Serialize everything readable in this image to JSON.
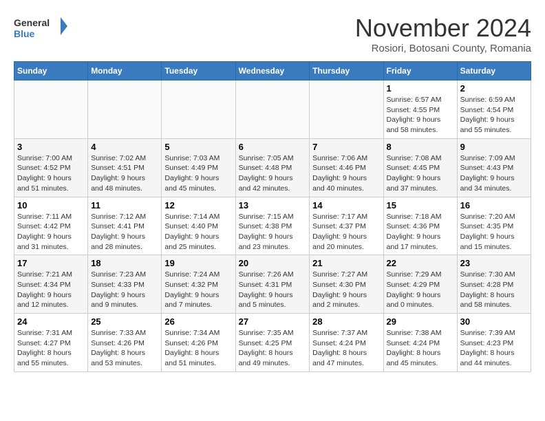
{
  "logo": {
    "line1": "General",
    "line2": "Blue"
  },
  "title": "November 2024",
  "subtitle": "Rosiori, Botosani County, Romania",
  "days_of_week": [
    "Sunday",
    "Monday",
    "Tuesday",
    "Wednesday",
    "Thursday",
    "Friday",
    "Saturday"
  ],
  "weeks": [
    [
      {
        "day": "",
        "info": ""
      },
      {
        "day": "",
        "info": ""
      },
      {
        "day": "",
        "info": ""
      },
      {
        "day": "",
        "info": ""
      },
      {
        "day": "",
        "info": ""
      },
      {
        "day": "1",
        "info": "Sunrise: 6:57 AM\nSunset: 4:55 PM\nDaylight: 9 hours and 58 minutes."
      },
      {
        "day": "2",
        "info": "Sunrise: 6:59 AM\nSunset: 4:54 PM\nDaylight: 9 hours and 55 minutes."
      }
    ],
    [
      {
        "day": "3",
        "info": "Sunrise: 7:00 AM\nSunset: 4:52 PM\nDaylight: 9 hours and 51 minutes."
      },
      {
        "day": "4",
        "info": "Sunrise: 7:02 AM\nSunset: 4:51 PM\nDaylight: 9 hours and 48 minutes."
      },
      {
        "day": "5",
        "info": "Sunrise: 7:03 AM\nSunset: 4:49 PM\nDaylight: 9 hours and 45 minutes."
      },
      {
        "day": "6",
        "info": "Sunrise: 7:05 AM\nSunset: 4:48 PM\nDaylight: 9 hours and 42 minutes."
      },
      {
        "day": "7",
        "info": "Sunrise: 7:06 AM\nSunset: 4:46 PM\nDaylight: 9 hours and 40 minutes."
      },
      {
        "day": "8",
        "info": "Sunrise: 7:08 AM\nSunset: 4:45 PM\nDaylight: 9 hours and 37 minutes."
      },
      {
        "day": "9",
        "info": "Sunrise: 7:09 AM\nSunset: 4:43 PM\nDaylight: 9 hours and 34 minutes."
      }
    ],
    [
      {
        "day": "10",
        "info": "Sunrise: 7:11 AM\nSunset: 4:42 PM\nDaylight: 9 hours and 31 minutes."
      },
      {
        "day": "11",
        "info": "Sunrise: 7:12 AM\nSunset: 4:41 PM\nDaylight: 9 hours and 28 minutes."
      },
      {
        "day": "12",
        "info": "Sunrise: 7:14 AM\nSunset: 4:40 PM\nDaylight: 9 hours and 25 minutes."
      },
      {
        "day": "13",
        "info": "Sunrise: 7:15 AM\nSunset: 4:38 PM\nDaylight: 9 hours and 23 minutes."
      },
      {
        "day": "14",
        "info": "Sunrise: 7:17 AM\nSunset: 4:37 PM\nDaylight: 9 hours and 20 minutes."
      },
      {
        "day": "15",
        "info": "Sunrise: 7:18 AM\nSunset: 4:36 PM\nDaylight: 9 hours and 17 minutes."
      },
      {
        "day": "16",
        "info": "Sunrise: 7:20 AM\nSunset: 4:35 PM\nDaylight: 9 hours and 15 minutes."
      }
    ],
    [
      {
        "day": "17",
        "info": "Sunrise: 7:21 AM\nSunset: 4:34 PM\nDaylight: 9 hours and 12 minutes."
      },
      {
        "day": "18",
        "info": "Sunrise: 7:23 AM\nSunset: 4:33 PM\nDaylight: 9 hours and 9 minutes."
      },
      {
        "day": "19",
        "info": "Sunrise: 7:24 AM\nSunset: 4:32 PM\nDaylight: 9 hours and 7 minutes."
      },
      {
        "day": "20",
        "info": "Sunrise: 7:26 AM\nSunset: 4:31 PM\nDaylight: 9 hours and 5 minutes."
      },
      {
        "day": "21",
        "info": "Sunrise: 7:27 AM\nSunset: 4:30 PM\nDaylight: 9 hours and 2 minutes."
      },
      {
        "day": "22",
        "info": "Sunrise: 7:29 AM\nSunset: 4:29 PM\nDaylight: 9 hours and 0 minutes."
      },
      {
        "day": "23",
        "info": "Sunrise: 7:30 AM\nSunset: 4:28 PM\nDaylight: 8 hours and 58 minutes."
      }
    ],
    [
      {
        "day": "24",
        "info": "Sunrise: 7:31 AM\nSunset: 4:27 PM\nDaylight: 8 hours and 55 minutes."
      },
      {
        "day": "25",
        "info": "Sunrise: 7:33 AM\nSunset: 4:26 PM\nDaylight: 8 hours and 53 minutes."
      },
      {
        "day": "26",
        "info": "Sunrise: 7:34 AM\nSunset: 4:26 PM\nDaylight: 8 hours and 51 minutes."
      },
      {
        "day": "27",
        "info": "Sunrise: 7:35 AM\nSunset: 4:25 PM\nDaylight: 8 hours and 49 minutes."
      },
      {
        "day": "28",
        "info": "Sunrise: 7:37 AM\nSunset: 4:24 PM\nDaylight: 8 hours and 47 minutes."
      },
      {
        "day": "29",
        "info": "Sunrise: 7:38 AM\nSunset: 4:24 PM\nDaylight: 8 hours and 45 minutes."
      },
      {
        "day": "30",
        "info": "Sunrise: 7:39 AM\nSunset: 4:23 PM\nDaylight: 8 hours and 44 minutes."
      }
    ]
  ]
}
